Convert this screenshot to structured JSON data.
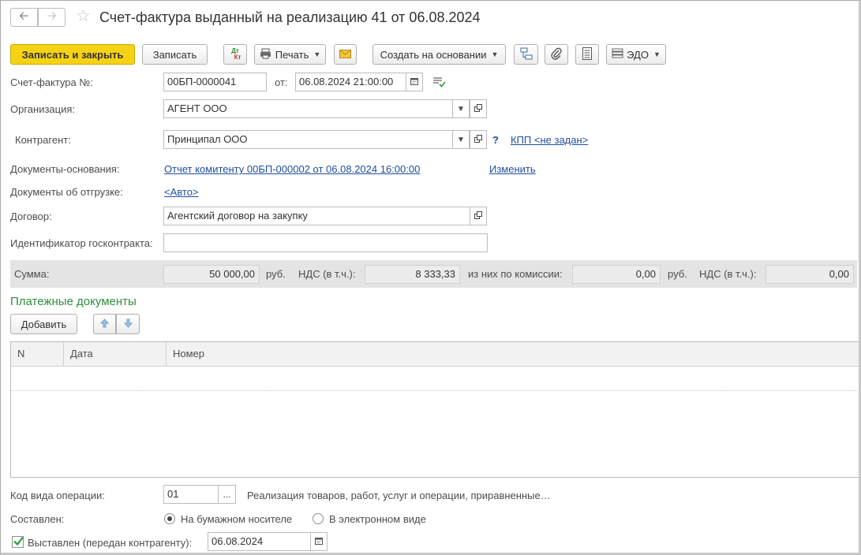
{
  "header": {
    "title": "Счет-фактура выданный на реализацию 41 от 06.08.2024"
  },
  "toolbar": {
    "save_close": "Записать и закрыть",
    "save": "Записать",
    "dtkt_top": "Дт",
    "dtkt_bottom": "Кт",
    "print": "Печать",
    "create_based": "Создать на основании",
    "edo": "ЭДО"
  },
  "form": {
    "invoice_label": "Счет-фактура №:",
    "invoice_number": "00БП-0000041",
    "from_label": "от:",
    "date": "06.08.2024 21:00:00",
    "org_label": "Организация:",
    "org_value": "АГЕНТ ООО",
    "contractor_label": "Контрагент:",
    "contractor_value": "Принципал ООО",
    "question": "?",
    "kpp_link": "КПП <не задан>",
    "base_docs_label": "Документы-основания:",
    "base_docs_link": "Отчет комитенту 00БП-000002 от 06.08.2024 16:00:00",
    "change_link": "Изменить",
    "shipment_label": "Документы об отгрузке:",
    "shipment_link": "<Авто>",
    "contract_label": "Договор:",
    "contract_value": "Агентский договор на закупку",
    "gov_id_label": "Идентификатор госконтракта:",
    "gov_id_value": ""
  },
  "sums": {
    "sum_label": "Сумма:",
    "sum_value": "50 000,00",
    "currency1": "руб.",
    "vat_label1": "НДС (в т.ч.):",
    "vat_value1": "8 333,33",
    "commission_label": "из них по комиссии:",
    "commission_value": "0,00",
    "currency2": "руб.",
    "vat_label2": "НДС (в т.ч.):",
    "vat_value2": "0,00"
  },
  "payments": {
    "title": "Платежные документы",
    "add_button": "Добавить",
    "columns": [
      "N",
      "Дата",
      "Номер"
    ]
  },
  "footer": {
    "op_code_label": "Код вида операции:",
    "op_code_value": "01",
    "op_code_desc": "Реализация товаров, работ, услуг и операции, приравненные…",
    "composed_label": "Составлен:",
    "paper_option": "На бумажном носителе",
    "electronic_option": "В электронном виде",
    "issued_label": "Выставлен (передан контрагенту):",
    "issued_date": "06.08.2024",
    "issued_checked": true,
    "composed_selected": "paper"
  },
  "colors": {
    "primary_button": "#f5d214",
    "link": "#1f4e9e",
    "section_title": "#2f8f3b"
  }
}
